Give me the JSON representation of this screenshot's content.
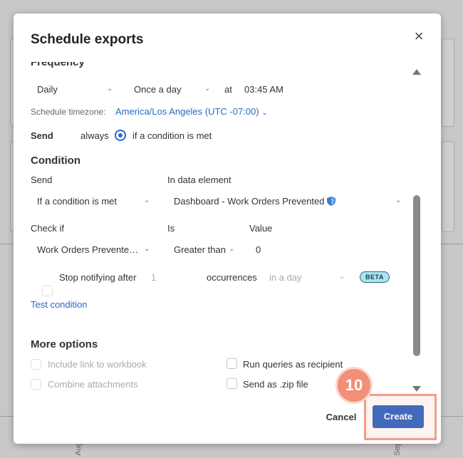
{
  "modal": {
    "title": "Schedule exports",
    "close_label": "×"
  },
  "frequency": {
    "heading": "Frequency",
    "period": "Daily",
    "repeat": "Once a day",
    "at_label": "at",
    "time": "03:45 AM"
  },
  "timezone": {
    "label": "Schedule timezone:",
    "value": "America/Los Angeles (UTC -07:00)"
  },
  "send_mode": {
    "label": "Send",
    "option_always": "always",
    "option_condition": "if a condition is met",
    "selected": "if a condition is met"
  },
  "condition": {
    "heading": "Condition",
    "send_label": "Send",
    "send_value": "If a condition is met",
    "data_element_label": "In data element",
    "data_element_value": "Dashboard - Work Orders Prevented",
    "check_if_label": "Check if",
    "check_if_value": "Work Orders Prevente…",
    "is_label": "Is",
    "is_value": "Greater than",
    "value_label": "Value",
    "value_value": "0",
    "stop_label": "Stop notifying after",
    "stop_count": "1",
    "occurrences_label": "occurrences",
    "window_value": "in a day",
    "beta_label": "BETA",
    "test_link": "Test condition"
  },
  "more_options": {
    "heading": "More options",
    "include_link": "Include link to workbook",
    "combine_attachments": "Combine attachments",
    "run_as_recipient": "Run queries as recipient",
    "send_zip": "Send as .zip file"
  },
  "footer": {
    "cancel_label": "Cancel",
    "create_label": "Create"
  },
  "annotation": {
    "step_number": "10",
    "highlight_color": "#f29a8a"
  },
  "background": {
    "axis_label_left": "Aug",
    "axis_label_right": "Sep"
  },
  "colors": {
    "accent": "#2a63c4",
    "link": "#2a6ac6",
    "beta_bg": "#aee3ee"
  }
}
